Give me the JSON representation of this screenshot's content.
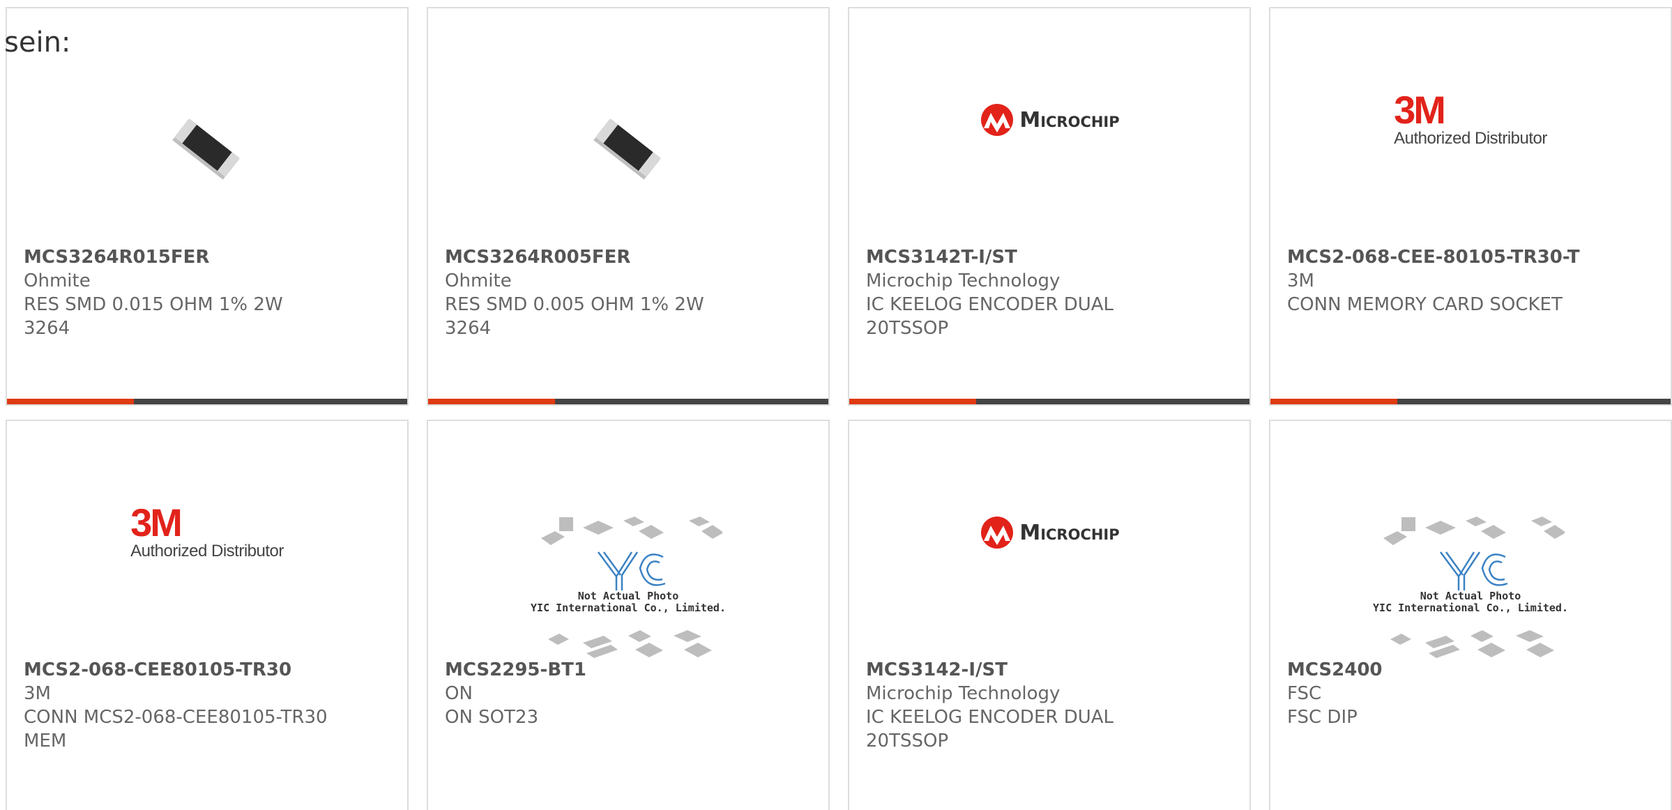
{
  "intro_text": "sein:",
  "colors": {
    "accent": "#e03a12",
    "bar": "#444444",
    "border": "#dddddd",
    "text": "#666666"
  },
  "logos": {
    "microchip_word": "Microchip",
    "threem_mark": "3M",
    "threem_caption": "Authorized Distributor",
    "yic_mark": "YIC",
    "yic_note_1": "Not Actual Photo",
    "yic_note_2": "YIC International Co., Limited."
  },
  "products": [
    {
      "part": "MCS3264R015FER",
      "maker": "Ohmite",
      "desc1": "RES SMD 0.015 OHM 1% 2W",
      "desc2": "3264",
      "image": "resistor-image"
    },
    {
      "part": "MCS3264R005FER",
      "maker": "Ohmite",
      "desc1": "RES SMD 0.005 OHM 1% 2W",
      "desc2": "3264",
      "image": "resistor-image"
    },
    {
      "part": "MCS3142T-I/ST",
      "maker": "Microchip Technology",
      "desc1": "IC KEELOG ENCODER DUAL",
      "desc2": "20TSSOP",
      "image": "microchip-logo"
    },
    {
      "part": "MCS2-068-CEE-80105-TR30-T",
      "maker": "3M",
      "desc1": "CONN MEMORY CARD SOCKET",
      "desc2": "",
      "image": "3m-logo"
    },
    {
      "part": "MCS2-068-CEE80105-TR30",
      "maker": "3M",
      "desc1": "CONN MCS2-068-CEE80105-TR30",
      "desc2": "MEM",
      "image": "3m-logo"
    },
    {
      "part": "MCS2295-BT1",
      "maker": "ON",
      "desc1": "ON SOT23",
      "desc2": "",
      "image": "yic-placeholder"
    },
    {
      "part": "MCS3142-I/ST",
      "maker": "Microchip Technology",
      "desc1": "IC KEELOG ENCODER DUAL",
      "desc2": "20TSSOP",
      "image": "microchip-logo"
    },
    {
      "part": "MCS2400",
      "maker": "FSC",
      "desc1": "FSC DIP",
      "desc2": "",
      "image": "yic-placeholder"
    }
  ]
}
